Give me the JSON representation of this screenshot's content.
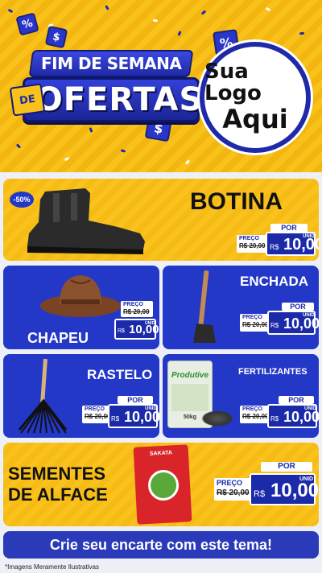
{
  "header": {
    "title_line1": "FIM DE SEMANA",
    "title_de": "DE",
    "title_line2": "OFERTAS",
    "logo_line1": "Sua Logo",
    "logo_line2": "Aqui",
    "cube_symbols": [
      "%",
      "$",
      "%",
      "$"
    ]
  },
  "products": [
    {
      "name": "BOTINA",
      "badge": "-50%",
      "por_label": "POR",
      "preco_label": "PREÇO",
      "old_price": "R$ 20,00",
      "currency": "R$",
      "price": "10,00",
      "unit": "UNID"
    },
    {
      "name": "CHAPEU",
      "por_label": "POR",
      "preco_label": "PREÇO",
      "old_price": "R$ 20,00",
      "currency": "R$",
      "price": "10,00",
      "unit": "UNID"
    },
    {
      "name": "ENCHADA",
      "por_label": "POR",
      "preco_label": "PREÇO",
      "old_price": "R$ 20,00",
      "currency": "R$",
      "price": "10,00",
      "unit": "UNID"
    },
    {
      "name": "RASTELO",
      "por_label": "POR",
      "preco_label": "PREÇO",
      "old_price": "R$ 20,00",
      "currency": "R$",
      "price": "10,00",
      "unit": "UNID"
    },
    {
      "name": "FERTILIZANTES",
      "bag_brand": "Produtive",
      "bag_weight": "50kg",
      "por_label": "POR",
      "preco_label": "PREÇO",
      "old_price": "R$ 20,00",
      "currency": "R$",
      "price": "10,00",
      "unit": "UNID"
    },
    {
      "name_line1": "SEMENTES",
      "name_line2": "DE ALFACE",
      "packet_brand": "SAKATA",
      "por_label": "POR",
      "preco_label": "PREÇO",
      "old_price": "R$ 20,00",
      "currency": "R$",
      "price": "10,00",
      "unit": "UNID"
    }
  ],
  "cta": "Crie seu encarte com este tema!",
  "footer_note": "*Imagens Meramente Ilustrativas",
  "colors": {
    "yellow": "#f9c21c",
    "blue": "#2438c8",
    "dark_blue": "#1a2aa8"
  }
}
